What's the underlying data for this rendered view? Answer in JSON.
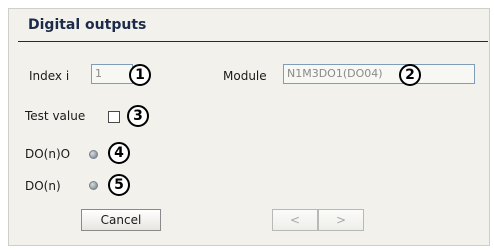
{
  "panel": {
    "title": "Digital outputs"
  },
  "index": {
    "label": "Index i",
    "value": "1"
  },
  "module": {
    "label": "Module",
    "value": "N1M3DO1(DO04)"
  },
  "test_value": {
    "label": "Test value",
    "checked": false
  },
  "do_n_o": {
    "label": "DO(n)O",
    "led_state": "off"
  },
  "do_n": {
    "label": "DO(n)",
    "led_state": "off"
  },
  "buttons": {
    "cancel": "Cancel",
    "prev": "<",
    "next": ">"
  },
  "callouts": [
    "1",
    "2",
    "3",
    "4",
    "5"
  ],
  "icons": {
    "led": "status-led-icon"
  }
}
